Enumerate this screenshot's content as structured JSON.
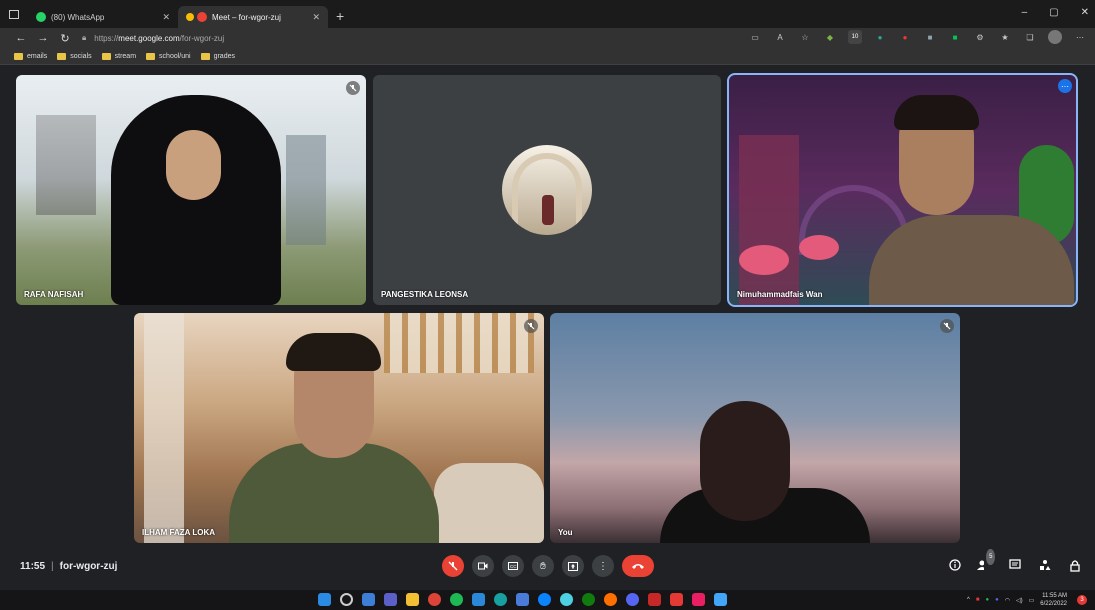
{
  "browser": {
    "tabs": [
      {
        "title": "(80) WhatsApp",
        "favicon_color": "#25d366",
        "active": false
      },
      {
        "title": "Meet – for-wgor-zuj",
        "favicon_color": "#ea4335",
        "active": true
      }
    ],
    "new_tab": "+",
    "window_controls": {
      "minimize": "–",
      "restore": "▢",
      "close": "✕"
    },
    "address": {
      "scheme": "https://",
      "host": "meet.google.com",
      "path": "/for-wgor-zuj"
    },
    "extension_badge": "10",
    "bookmarks": [
      "emails",
      "socials",
      "stream",
      "school/uni",
      "grades"
    ]
  },
  "meeting": {
    "participants": [
      {
        "name": "RAFA NAFISAH",
        "muted": true
      },
      {
        "name": "PANGESTIKA LEONSA",
        "muted": false
      },
      {
        "name": "Nimuhammadfais Wan",
        "muted": false,
        "active_speaker": true
      },
      {
        "name": "ILHAM FAZA LOKA",
        "muted": true
      },
      {
        "name": "You",
        "muted": true
      }
    ],
    "time": "11:55",
    "code": "for-wgor-zuj",
    "people_count": "5",
    "controls": [
      "mic-off",
      "camera",
      "captions",
      "raise-hand",
      "present",
      "more",
      "leave"
    ],
    "right_controls": [
      "info",
      "people",
      "chat",
      "activities",
      "host-controls"
    ]
  },
  "taskbar": {
    "time": "11:55 AM",
    "date": "6/22/2022",
    "notification_count": "3"
  },
  "colors": {
    "accent": "#8ab4f8",
    "danger": "#ea4335",
    "surface": "#202124",
    "tile": "#3c4043"
  }
}
